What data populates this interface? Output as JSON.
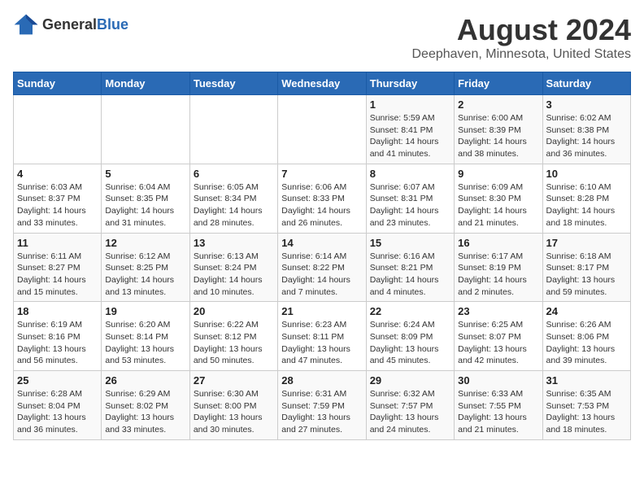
{
  "logo": {
    "general": "General",
    "blue": "Blue"
  },
  "title": "August 2024",
  "subtitle": "Deephaven, Minnesota, United States",
  "days_of_week": [
    "Sunday",
    "Monday",
    "Tuesday",
    "Wednesday",
    "Thursday",
    "Friday",
    "Saturday"
  ],
  "weeks": [
    [
      {
        "day": "",
        "sunrise": "",
        "sunset": "",
        "daylight": ""
      },
      {
        "day": "",
        "sunrise": "",
        "sunset": "",
        "daylight": ""
      },
      {
        "day": "",
        "sunrise": "",
        "sunset": "",
        "daylight": ""
      },
      {
        "day": "",
        "sunrise": "",
        "sunset": "",
        "daylight": ""
      },
      {
        "day": "1",
        "sunrise": "Sunrise: 5:59 AM",
        "sunset": "Sunset: 8:41 PM",
        "daylight": "Daylight: 14 hours and 41 minutes."
      },
      {
        "day": "2",
        "sunrise": "Sunrise: 6:00 AM",
        "sunset": "Sunset: 8:39 PM",
        "daylight": "Daylight: 14 hours and 38 minutes."
      },
      {
        "day": "3",
        "sunrise": "Sunrise: 6:02 AM",
        "sunset": "Sunset: 8:38 PM",
        "daylight": "Daylight: 14 hours and 36 minutes."
      }
    ],
    [
      {
        "day": "4",
        "sunrise": "Sunrise: 6:03 AM",
        "sunset": "Sunset: 8:37 PM",
        "daylight": "Daylight: 14 hours and 33 minutes."
      },
      {
        "day": "5",
        "sunrise": "Sunrise: 6:04 AM",
        "sunset": "Sunset: 8:35 PM",
        "daylight": "Daylight: 14 hours and 31 minutes."
      },
      {
        "day": "6",
        "sunrise": "Sunrise: 6:05 AM",
        "sunset": "Sunset: 8:34 PM",
        "daylight": "Daylight: 14 hours and 28 minutes."
      },
      {
        "day": "7",
        "sunrise": "Sunrise: 6:06 AM",
        "sunset": "Sunset: 8:33 PM",
        "daylight": "Daylight: 14 hours and 26 minutes."
      },
      {
        "day": "8",
        "sunrise": "Sunrise: 6:07 AM",
        "sunset": "Sunset: 8:31 PM",
        "daylight": "Daylight: 14 hours and 23 minutes."
      },
      {
        "day": "9",
        "sunrise": "Sunrise: 6:09 AM",
        "sunset": "Sunset: 8:30 PM",
        "daylight": "Daylight: 14 hours and 21 minutes."
      },
      {
        "day": "10",
        "sunrise": "Sunrise: 6:10 AM",
        "sunset": "Sunset: 8:28 PM",
        "daylight": "Daylight: 14 hours and 18 minutes."
      }
    ],
    [
      {
        "day": "11",
        "sunrise": "Sunrise: 6:11 AM",
        "sunset": "Sunset: 8:27 PM",
        "daylight": "Daylight: 14 hours and 15 minutes."
      },
      {
        "day": "12",
        "sunrise": "Sunrise: 6:12 AM",
        "sunset": "Sunset: 8:25 PM",
        "daylight": "Daylight: 14 hours and 13 minutes."
      },
      {
        "day": "13",
        "sunrise": "Sunrise: 6:13 AM",
        "sunset": "Sunset: 8:24 PM",
        "daylight": "Daylight: 14 hours and 10 minutes."
      },
      {
        "day": "14",
        "sunrise": "Sunrise: 6:14 AM",
        "sunset": "Sunset: 8:22 PM",
        "daylight": "Daylight: 14 hours and 7 minutes."
      },
      {
        "day": "15",
        "sunrise": "Sunrise: 6:16 AM",
        "sunset": "Sunset: 8:21 PM",
        "daylight": "Daylight: 14 hours and 4 minutes."
      },
      {
        "day": "16",
        "sunrise": "Sunrise: 6:17 AM",
        "sunset": "Sunset: 8:19 PM",
        "daylight": "Daylight: 14 hours and 2 minutes."
      },
      {
        "day": "17",
        "sunrise": "Sunrise: 6:18 AM",
        "sunset": "Sunset: 8:17 PM",
        "daylight": "Daylight: 13 hours and 59 minutes."
      }
    ],
    [
      {
        "day": "18",
        "sunrise": "Sunrise: 6:19 AM",
        "sunset": "Sunset: 8:16 PM",
        "daylight": "Daylight: 13 hours and 56 minutes."
      },
      {
        "day": "19",
        "sunrise": "Sunrise: 6:20 AM",
        "sunset": "Sunset: 8:14 PM",
        "daylight": "Daylight: 13 hours and 53 minutes."
      },
      {
        "day": "20",
        "sunrise": "Sunrise: 6:22 AM",
        "sunset": "Sunset: 8:12 PM",
        "daylight": "Daylight: 13 hours and 50 minutes."
      },
      {
        "day": "21",
        "sunrise": "Sunrise: 6:23 AM",
        "sunset": "Sunset: 8:11 PM",
        "daylight": "Daylight: 13 hours and 47 minutes."
      },
      {
        "day": "22",
        "sunrise": "Sunrise: 6:24 AM",
        "sunset": "Sunset: 8:09 PM",
        "daylight": "Daylight: 13 hours and 45 minutes."
      },
      {
        "day": "23",
        "sunrise": "Sunrise: 6:25 AM",
        "sunset": "Sunset: 8:07 PM",
        "daylight": "Daylight: 13 hours and 42 minutes."
      },
      {
        "day": "24",
        "sunrise": "Sunrise: 6:26 AM",
        "sunset": "Sunset: 8:06 PM",
        "daylight": "Daylight: 13 hours and 39 minutes."
      }
    ],
    [
      {
        "day": "25",
        "sunrise": "Sunrise: 6:28 AM",
        "sunset": "Sunset: 8:04 PM",
        "daylight": "Daylight: 13 hours and 36 minutes."
      },
      {
        "day": "26",
        "sunrise": "Sunrise: 6:29 AM",
        "sunset": "Sunset: 8:02 PM",
        "daylight": "Daylight: 13 hours and 33 minutes."
      },
      {
        "day": "27",
        "sunrise": "Sunrise: 6:30 AM",
        "sunset": "Sunset: 8:00 PM",
        "daylight": "Daylight: 13 hours and 30 minutes."
      },
      {
        "day": "28",
        "sunrise": "Sunrise: 6:31 AM",
        "sunset": "Sunset: 7:59 PM",
        "daylight": "Daylight: 13 hours and 27 minutes."
      },
      {
        "day": "29",
        "sunrise": "Sunrise: 6:32 AM",
        "sunset": "Sunset: 7:57 PM",
        "daylight": "Daylight: 13 hours and 24 minutes."
      },
      {
        "day": "30",
        "sunrise": "Sunrise: 6:33 AM",
        "sunset": "Sunset: 7:55 PM",
        "daylight": "Daylight: 13 hours and 21 minutes."
      },
      {
        "day": "31",
        "sunrise": "Sunrise: 6:35 AM",
        "sunset": "Sunset: 7:53 PM",
        "daylight": "Daylight: 13 hours and 18 minutes."
      }
    ]
  ]
}
